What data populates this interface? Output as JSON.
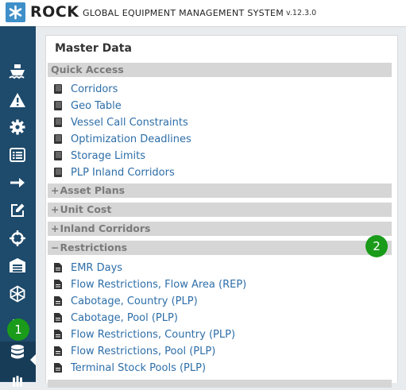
{
  "header": {
    "brand": "ROCK",
    "subtitle": "GLOBAL EQUIPMENT MANAGEMENT SYSTEM",
    "version": "v.12.3.0",
    "logo_icon": "asterisk-logo-icon"
  },
  "sidebar": {
    "icons": [
      "ship-icon",
      "warning-icon",
      "gear-icon",
      "list-icon",
      "arrow-right-icon",
      "edit-icon",
      "crosshair-icon",
      "warehouse-icon",
      "network-icon",
      "file-icon",
      "database-icon",
      "hand-icon"
    ],
    "active": "database-icon"
  },
  "panel": {
    "title": "Master Data",
    "quick_access": {
      "label": "Quick Access",
      "items": [
        "Corridors",
        "Geo Table",
        "Vessel Call Constraints",
        "Optimization Deadlines",
        "Storage Limits",
        "PLP Inland Corridors"
      ]
    },
    "collapsed_sections": [
      {
        "sign": "+",
        "label": "Asset Plans"
      },
      {
        "sign": "+",
        "label": "Unit Cost"
      },
      {
        "sign": "+",
        "label": "Inland Corridors"
      }
    ],
    "restrictions": {
      "sign": "−",
      "label": "Restrictions",
      "items": [
        "EMR Days",
        "Flow Restrictions, Flow Area (REP)",
        "Cabotage, Country (PLP)",
        "Cabotage, Pool (PLP)",
        "Flow Restrictions, Country (PLP)",
        "Flow Restrictions, Pool (PLP)",
        "Terminal Stock Pools (PLP)"
      ]
    }
  },
  "badges": {
    "one": "1",
    "two": "2"
  },
  "colors": {
    "sidebar": "#1e4a6b",
    "link": "#2d6ea8",
    "section_bg": "#d6d6d6",
    "badge": "#1a9b1a",
    "logo": "#3f8fc8"
  }
}
